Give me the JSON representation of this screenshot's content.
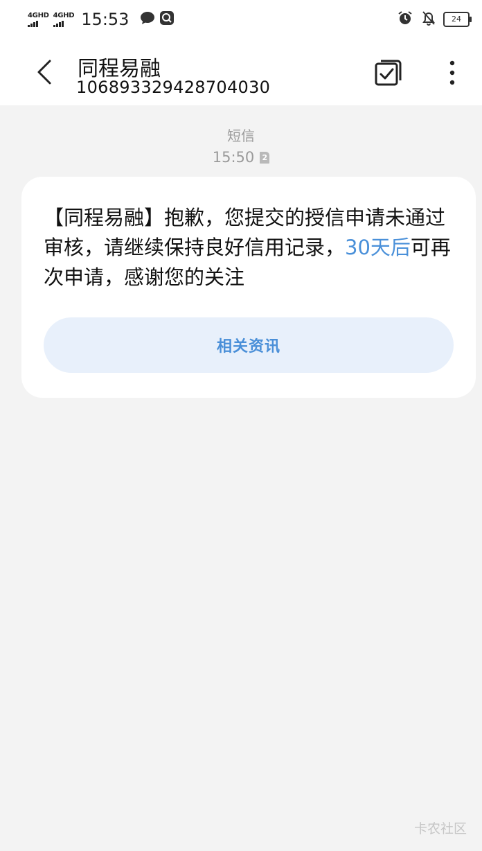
{
  "status_bar": {
    "network1": "4GHD",
    "network2": "4GHD",
    "time": "15:53",
    "battery": "24",
    "icons": [
      "message-bubble-icon",
      "search-app-icon",
      "alarm-icon",
      "bell-off-icon",
      "battery-icon"
    ]
  },
  "header": {
    "contact_name": "同程易融",
    "contact_number": "106893329428704030",
    "icons": [
      "back-arrow-icon",
      "select-check-icon",
      "more-vertical-icon"
    ]
  },
  "conversation": {
    "type": "短信",
    "time": "15:50",
    "sim_slot": "2"
  },
  "message": {
    "text_before": "【同程易融】抱歉，您提交的授信申请未通过审核，请继续保持良好信用记录，",
    "link_text": "30天后",
    "text_after": "可再次申请，感谢您的关注",
    "related_button": "相关资讯"
  },
  "watermark": "卡农社区",
  "colors": {
    "accent": "#4a90d9",
    "background": "#f3f3f3",
    "card": "#ffffff",
    "button_bg": "#e8f0fb"
  }
}
